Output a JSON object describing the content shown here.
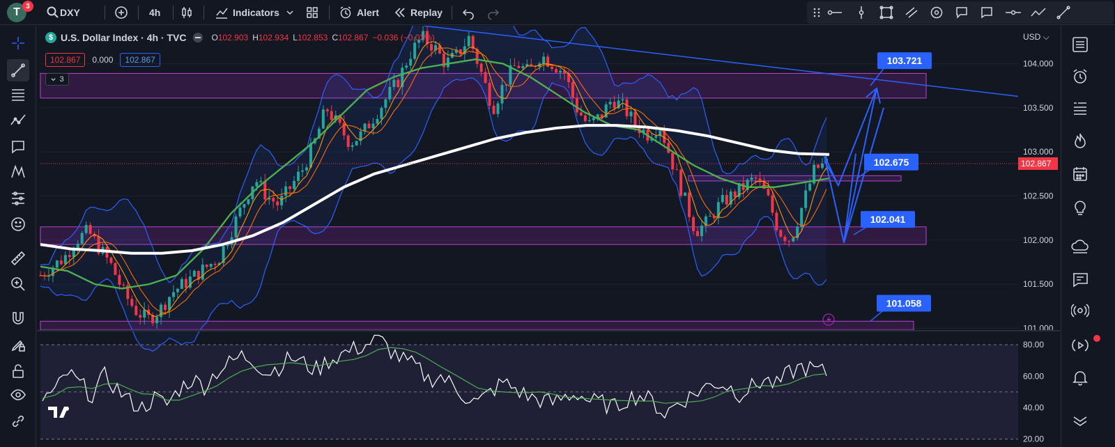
{
  "header": {
    "avatar_letter": "T",
    "avatar_badge": "3",
    "symbol": "DXY",
    "interval": "4h",
    "indicators_label": "Indicators",
    "alert_label": "Alert",
    "replay_label": "Replay"
  },
  "legend": {
    "symbol_icon": "$",
    "title": "U.S. Dollar Index · 4h · TVC",
    "open_label": "O",
    "open": "102.903",
    "high_label": "H",
    "high": "102.934",
    "low_label": "L",
    "low": "102.853",
    "close_label": "C",
    "close": "102.867",
    "change": "−0.036 (−0.03%)",
    "bid": "102.867",
    "spread": "0.000",
    "ask": "102.867",
    "indicator_count": "3"
  },
  "axis": {
    "currency": "USD",
    "current_price": "102.867"
  },
  "colors": {
    "background": "#131722",
    "up": "#26a69a",
    "down": "#f23645",
    "zone": "#9c27b0",
    "callout": "#2962ff",
    "ma200": "#ffffff",
    "ma50": "#4caf50",
    "ema": "#ff9800"
  },
  "chart_data": [
    {
      "type": "line",
      "title": "U.S. Dollar Index · 4h · TVC",
      "ylim": [
        100.98,
        104.43
      ],
      "yticks": [
        "104.000",
        "103.500",
        "103.000",
        "102.500",
        "102.000",
        "101.500",
        "101.000"
      ],
      "current_price": 102.867,
      "zones": [
        {
          "low": 103.61,
          "high": 103.89
        },
        {
          "low": 102.67,
          "high": 102.73
        },
        {
          "low": 101.95,
          "high": 102.15
        },
        {
          "low": 100.98,
          "high": 101.08
        }
      ],
      "trendline": {
        "from": 104.43,
        "to": 103.63
      },
      "projection_labels": [
        "103.721",
        "102.675",
        "102.041",
        "101.058"
      ],
      "series": [
        {
          "values": [
            101.6,
            101.7,
            101.8,
            102.0,
            102.1,
            101.9,
            101.7,
            101.4,
            101.2,
            101.1,
            101.2,
            101.4,
            101.5,
            101.6,
            101.7,
            101.8,
            102.1,
            102.4,
            102.7,
            102.5,
            102.4,
            102.6,
            102.8,
            103.1,
            103.5,
            103.3,
            103.1,
            103.2,
            103.4,
            103.6,
            103.8,
            104.1,
            104.3,
            104.2,
            104.0,
            104.1,
            104.3,
            103.9,
            103.5,
            103.8,
            104.0,
            103.9,
            104.1,
            104.0,
            103.9,
            103.5,
            103.3,
            103.4,
            103.6,
            103.5,
            103.3,
            103.2,
            103.3,
            102.9,
            102.5,
            102.1,
            102.2,
            102.4,
            102.5,
            102.6,
            102.7,
            102.5,
            102.1,
            102.0,
            102.4,
            102.8,
            102.87
          ]
        },
        {
          "values": [
            101.95,
            101.9,
            101.88,
            101.85,
            101.85,
            101.88,
            101.95,
            102.05,
            102.2,
            102.4,
            102.6,
            102.75,
            102.85,
            102.95,
            103.05,
            103.15,
            103.22,
            103.27,
            103.3,
            103.3,
            103.28,
            103.24,
            103.18,
            103.1,
            103.02,
            102.98,
            102.97
          ]
        },
        {
          "values": [
            101.7,
            101.65,
            101.5,
            101.45,
            101.5,
            101.6,
            101.9,
            102.3,
            102.6,
            102.85,
            103.1,
            103.4,
            103.7,
            103.85,
            103.95,
            104.0,
            104.05,
            104.0,
            103.85,
            103.65,
            103.45,
            103.3,
            103.25,
            103.05,
            102.85,
            102.7,
            102.6,
            102.6,
            102.65,
            102.7
          ]
        },
        {
          "name": "RSI",
          "values": [
            46,
            50,
            62,
            55,
            48,
            60,
            52,
            44,
            40,
            46,
            42,
            52,
            58,
            54,
            63,
            68,
            73,
            70,
            62,
            66,
            72,
            68,
            64,
            70,
            74,
            77,
            80,
            84,
            76,
            70,
            66,
            58,
            60,
            54,
            47,
            43,
            50,
            56,
            52,
            47,
            45,
            43,
            47,
            49,
            44,
            43,
            40,
            46,
            48,
            44,
            36,
            43,
            47,
            52,
            56,
            54,
            49,
            53,
            58,
            54,
            62,
            66,
            64,
            62
          ]
        }
      ]
    },
    {
      "type": "line",
      "title": "RSI",
      "ylim": [
        15,
        88
      ],
      "yticks": [
        "80.00",
        "60.00",
        "40.00",
        "20.00"
      ]
    }
  ]
}
